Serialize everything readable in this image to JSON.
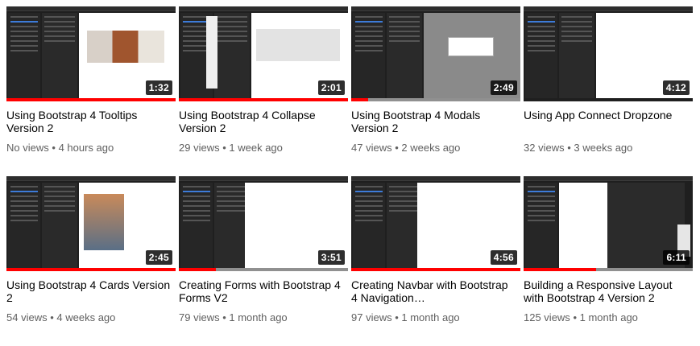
{
  "colors": {
    "progress": "#ff0000",
    "title": "#030303",
    "meta": "#606060"
  },
  "videos": [
    {
      "title": "Using Bootstrap 4 Tooltips Version 2",
      "duration": "1:32",
      "views": "No views",
      "age": "4 hours ago",
      "watched_percent": 100
    },
    {
      "title": "Using Bootstrap 4 Collapse Version 2",
      "duration": "2:01",
      "views": "29 views",
      "age": "1 week ago",
      "watched_percent": 100
    },
    {
      "title": "Using Bootstrap 4 Modals Version 2",
      "duration": "2:49",
      "views": "47 views",
      "age": "2 weeks ago",
      "watched_percent": 10
    },
    {
      "title": "Using App Connect Dropzone",
      "duration": "4:12",
      "views": "32 views",
      "age": "3 weeks ago",
      "watched_percent": 0
    },
    {
      "title": "Using Bootstrap 4 Cards Version 2",
      "duration": "2:45",
      "views": "54 views",
      "age": "4 weeks ago",
      "watched_percent": 100
    },
    {
      "title": "Creating Forms with Bootstrap 4 Forms V2",
      "duration": "3:51",
      "views": "79 views",
      "age": "1 month ago",
      "watched_percent": 22
    },
    {
      "title": "Creating Navbar with Bootstrap 4 Navigation…",
      "duration": "4:56",
      "views": "97 views",
      "age": "1 month ago",
      "watched_percent": 100
    },
    {
      "title": "Building a Responsive Layout with Bootstrap 4 Version 2",
      "duration": "6:11",
      "views": "125 views",
      "age": "1 month ago",
      "watched_percent": 43
    }
  ],
  "separator": "•"
}
